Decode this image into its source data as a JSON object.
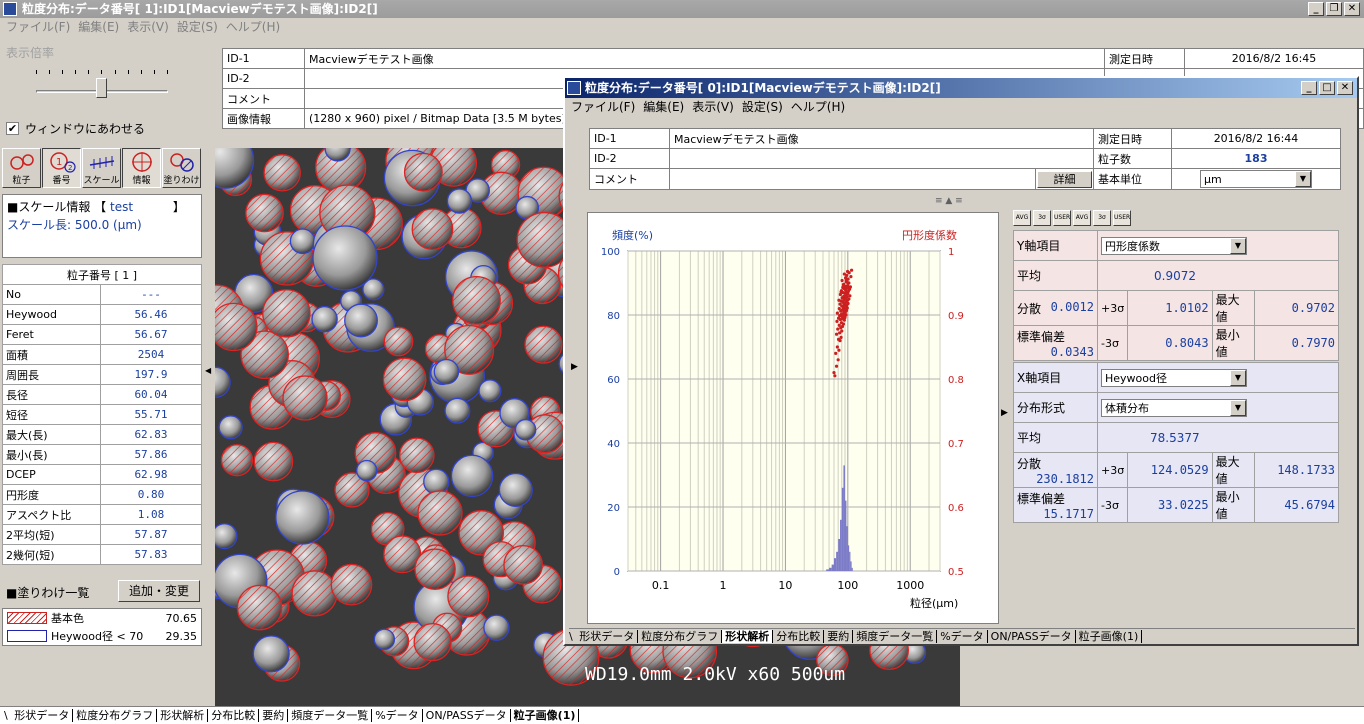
{
  "main_window": {
    "title": "粒度分布:データ番号[ 1]:ID1[Macviewデモテスト画像]:ID2[]",
    "menu": [
      "ファイル(F)",
      "編集(E)",
      "表示(V)",
      "設定(S)",
      "ヘルプ(H)"
    ]
  },
  "left_panel": {
    "slider_label": "表示倍率",
    "fit_window_label": "ウィンドウにあわせる",
    "fit_window_checked": true,
    "tools": [
      {
        "label": "粒子",
        "icon": "particle-icon"
      },
      {
        "label": "番号",
        "icon": "number-icon"
      },
      {
        "label": "スケール",
        "icon": "scale-icon"
      },
      {
        "label": "情報",
        "icon": "info-icon"
      },
      {
        "label": "塗りわけ",
        "icon": "paint-icon"
      }
    ],
    "scale_info": {
      "header": "■スケール情報",
      "name_open": "【",
      "name": "test",
      "name_close": "】",
      "length_label": "スケール長:",
      "length_value": "500.0 (μm)"
    },
    "particle_table": {
      "header": "粒子番号 [ 1 ]",
      "rows": [
        {
          "label": "No",
          "value": "---"
        },
        {
          "label": "Heywood",
          "value": "56.46"
        },
        {
          "label": "Feret",
          "value": "56.67"
        },
        {
          "label": "面積",
          "value": "2504"
        },
        {
          "label": "周囲長",
          "value": "197.9"
        },
        {
          "label": "長径",
          "value": "60.04"
        },
        {
          "label": "短径",
          "value": "55.71"
        },
        {
          "label": "最大(長)",
          "value": "62.83"
        },
        {
          "label": "最小(長)",
          "value": "57.86"
        },
        {
          "label": "DCEP",
          "value": "62.98"
        },
        {
          "label": "円形度",
          "value": "0.80"
        },
        {
          "label": "アスペクト比",
          "value": "1.08"
        },
        {
          "label": "2平均(短)",
          "value": "57.87"
        },
        {
          "label": "2幾何(短)",
          "value": "57.83"
        }
      ]
    },
    "paint_list": {
      "header": "■塗りわけ一覧",
      "button": "追加・変更",
      "items": [
        {
          "label": "基本色",
          "value": "70.65",
          "color": "#cc2222",
          "style": "hatch"
        },
        {
          "label": "Heywood径 < 70",
          "value": "29.35",
          "color": "#2233aa",
          "style": "outline"
        }
      ]
    }
  },
  "info_table": {
    "id1_label": "ID-1",
    "id1_value": "Macviewデモテスト画像",
    "id2_label": "ID-2",
    "id2_value": "",
    "comment_label": "コメント",
    "comment_value": "",
    "image_info_label": "画像情報",
    "image_info_value": "(1280 x 960) pixel / Bitmap Data [3.5 M bytes]",
    "date_label": "測定日時",
    "date_value": "2016/8/2 16:45"
  },
  "sem_overlay": "WD19.0mm  2.0kV x60   500um",
  "child_window": {
    "title": "粒度分布:データ番号[ 0]:ID1[Macviewデモテスト画像]:ID2[]",
    "menu": [
      "ファイル(F)",
      "編集(E)",
      "表示(V)",
      "設定(S)",
      "ヘルプ(H)"
    ],
    "info": {
      "id1_label": "ID-1",
      "id1_value": "Macviewデモテスト画像",
      "id2_label": "ID-2",
      "id2_value": "",
      "comment_label": "コメント",
      "comment_value": "",
      "detail_button": "詳細",
      "date_label": "測定日時",
      "date_value": "2016/8/2 16:44",
      "count_label": "粒子数",
      "count_value": "183",
      "unit_label": "基本単位",
      "unit_value": "μm"
    },
    "y_panel": {
      "item_label": "Y軸項目",
      "item_value": "円形度係数",
      "mean_label": "平均",
      "mean_value": "0.9072",
      "var_label": "分散",
      "var_value": "0.0012",
      "p3s_label": "+3σ",
      "p3s_value": "1.0102",
      "max_label": "最大値",
      "max_value": "0.9702",
      "sd_label": "標準偏差",
      "sd_value": "0.0343",
      "m3s_label": "-3σ",
      "m3s_value": "0.8043",
      "min_label": "最小値",
      "min_value": "0.7970"
    },
    "x_panel": {
      "item_label": "X軸項目",
      "item_value": "Heywood径",
      "dist_label": "分布形式",
      "dist_value": "体積分布",
      "mean_label": "平均",
      "mean_value": "78.5377",
      "var_label": "分散",
      "var_value": "230.1812",
      "p3s_label": "+3σ",
      "p3s_value": "124.0529",
      "max_label": "最大値",
      "max_value": "148.1733",
      "sd_label": "標準偏差",
      "sd_value": "15.1717",
      "m3s_label": "-3σ",
      "m3s_value": "33.0225",
      "min_label": "最小値",
      "min_value": "45.6794"
    },
    "mini_buttons": [
      "AVG",
      "3σ",
      "USER",
      "AVG",
      "3σ",
      "USER"
    ],
    "tabs": [
      "形状データ",
      "粒度分布グラフ",
      "形状解析",
      "分布比較",
      "要約",
      "頻度データ一覧",
      "%データ",
      "ON/PASSデータ",
      "粒子画像(1)"
    ],
    "active_tab": 2
  },
  "bottom_tabs": [
    "形状データ",
    "粒度分布グラフ",
    "形状解析",
    "分布比較",
    "要約",
    "頻度データ一覧",
    "%データ",
    "ON/PASSデータ",
    "粒子画像(1)"
  ],
  "bottom_active_tab": 8,
  "chart_data": {
    "type": "scatter",
    "ylabel_left": "頻度(%)",
    "ylabel_right": "円形度係数",
    "xlabel": "粒径(μm)",
    "x_scale": "log",
    "xlim": [
      0.03,
      3000
    ],
    "x_ticks": [
      "0.1",
      "1",
      "10",
      "100",
      "1000"
    ],
    "ylim_left": [
      0,
      100
    ],
    "y_ticks_left": [
      "0",
      "20",
      "40",
      "60",
      "80",
      "100"
    ],
    "ylim_right": [
      0.5,
      1
    ],
    "y_ticks_right": [
      "0.5",
      "0.6",
      "0.7",
      "0.8",
      "0.9",
      "1"
    ],
    "grid": true,
    "histogram": {
      "color": "#7b7bc8",
      "bins_x": [
        45,
        50,
        55,
        60,
        65,
        70,
        75,
        80,
        85,
        90,
        95,
        100,
        105,
        110,
        115
      ],
      "values": [
        0.5,
        1,
        2,
        4,
        6,
        10,
        16,
        26,
        33,
        22,
        14,
        8,
        6,
        3,
        1
      ]
    },
    "scatter": {
      "color": "#cc2020",
      "points": [
        [
          62,
          0.805
        ],
        [
          60,
          0.81
        ],
        [
          66,
          0.82
        ],
        [
          70,
          0.83
        ],
        [
          64,
          0.84
        ],
        [
          72,
          0.845
        ],
        [
          68,
          0.85
        ],
        [
          75,
          0.86
        ],
        [
          71,
          0.862
        ],
        [
          78,
          0.865
        ],
        [
          66,
          0.87
        ],
        [
          74,
          0.872
        ],
        [
          80,
          0.875
        ],
        [
          69,
          0.878
        ],
        [
          77,
          0.88
        ],
        [
          82,
          0.882
        ],
        [
          73,
          0.884
        ],
        [
          85,
          0.886
        ],
        [
          79,
          0.888
        ],
        [
          67,
          0.89
        ],
        [
          88,
          0.892
        ],
        [
          76,
          0.893
        ],
        [
          83,
          0.894
        ],
        [
          71,
          0.895
        ],
        [
          90,
          0.896
        ],
        [
          81,
          0.897
        ],
        [
          86,
          0.898
        ],
        [
          74,
          0.899
        ],
        [
          93,
          0.9
        ],
        [
          79,
          0.901
        ],
        [
          84,
          0.902
        ],
        [
          68,
          0.903
        ],
        [
          91,
          0.904
        ],
        [
          87,
          0.905
        ],
        [
          77,
          0.906
        ],
        [
          95,
          0.907
        ],
        [
          82,
          0.908
        ],
        [
          89,
          0.909
        ],
        [
          73,
          0.91
        ],
        [
          98,
          0.911
        ],
        [
          85,
          0.912
        ],
        [
          92,
          0.913
        ],
        [
          80,
          0.914
        ],
        [
          96,
          0.915
        ],
        [
          88,
          0.916
        ],
        [
          75,
          0.917
        ],
        [
          101,
          0.918
        ],
        [
          90,
          0.919
        ],
        [
          83,
          0.92
        ],
        [
          94,
          0.921
        ],
        [
          78,
          0.922
        ],
        [
          99,
          0.923
        ],
        [
          87,
          0.924
        ],
        [
          104,
          0.925
        ],
        [
          91,
          0.926
        ],
        [
          81,
          0.927
        ],
        [
          97,
          0.928
        ],
        [
          86,
          0.929
        ],
        [
          108,
          0.93
        ],
        [
          93,
          0.931
        ],
        [
          76,
          0.932
        ],
        [
          100,
          0.933
        ],
        [
          89,
          0.934
        ],
        [
          84,
          0.935
        ],
        [
          95,
          0.936
        ],
        [
          102,
          0.937
        ],
        [
          79,
          0.938
        ],
        [
          92,
          0.939
        ],
        [
          106,
          0.94
        ],
        [
          88,
          0.941
        ],
        [
          97,
          0.942
        ],
        [
          83,
          0.943
        ],
        [
          110,
          0.944
        ],
        [
          90,
          0.945
        ],
        [
          99,
          0.946
        ],
        [
          86,
          0.948
        ],
        [
          104,
          0.95
        ],
        [
          94,
          0.952
        ],
        [
          81,
          0.954
        ],
        [
          101,
          0.956
        ],
        [
          92,
          0.958
        ],
        [
          112,
          0.96
        ],
        [
          96,
          0.962
        ],
        [
          88,
          0.964
        ],
        [
          105,
          0.966
        ],
        [
          99,
          0.968
        ],
        [
          115,
          0.97
        ],
        [
          94,
          0.955
        ],
        [
          85,
          0.947
        ],
        [
          78,
          0.936
        ],
        [
          107,
          0.941
        ],
        [
          72,
          0.923
        ],
        [
          98,
          0.951
        ],
        [
          87,
          0.918
        ],
        [
          103,
          0.944
        ]
      ]
    }
  }
}
